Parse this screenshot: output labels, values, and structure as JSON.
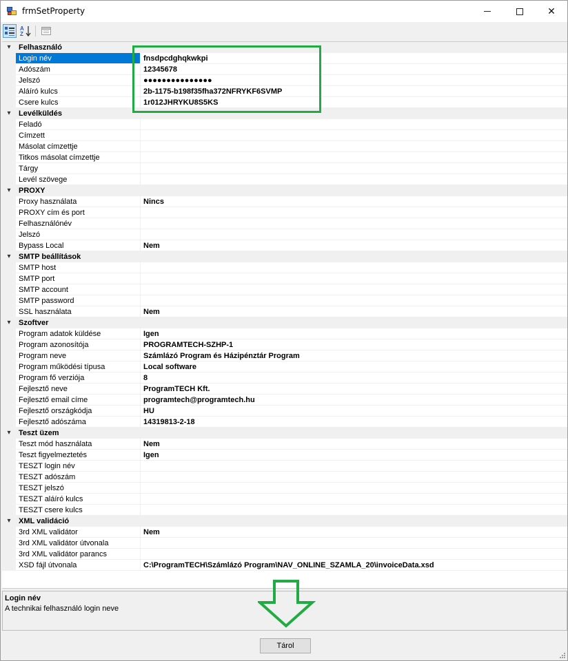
{
  "window": {
    "title": "frmSetProperty",
    "close_glyph": "✕"
  },
  "toolbar": {
    "icons": [
      "categorized-icon",
      "alphabetical-icon",
      "property-pages-icon"
    ]
  },
  "grid": {
    "categories": [
      {
        "label": "Felhasználó",
        "properties": [
          {
            "name": "Login név",
            "value": "fnsdpcdghqkwkpi",
            "selected": true
          },
          {
            "name": "Adószám",
            "value": "12345678"
          },
          {
            "name": "Jelszó",
            "value": "●●●●●●●●●●●●●●●"
          },
          {
            "name": "Aláíró kulcs",
            "value": "2b-1175-b198f35fha372NFRYKF6SVMP"
          },
          {
            "name": "Csere kulcs",
            "value": "1r012JHRYKU8S5KS"
          }
        ]
      },
      {
        "label": "Levélküldés",
        "properties": [
          {
            "name": "Feladó",
            "value": ""
          },
          {
            "name": "Címzett",
            "value": ""
          },
          {
            "name": "Másolat címzettje",
            "value": ""
          },
          {
            "name": "Titkos másolat címzettje",
            "value": ""
          },
          {
            "name": "Tárgy",
            "value": ""
          },
          {
            "name": "Levél szövege",
            "value": ""
          }
        ]
      },
      {
        "label": "PROXY",
        "properties": [
          {
            "name": "Proxy használata",
            "value": "Nincs"
          },
          {
            "name": "PROXY cím és port",
            "value": ""
          },
          {
            "name": "Felhasználónév",
            "value": ""
          },
          {
            "name": "Jelszó",
            "value": ""
          },
          {
            "name": "Bypass Local",
            "value": "Nem"
          }
        ]
      },
      {
        "label": "SMTP beállítások",
        "properties": [
          {
            "name": "SMTP host",
            "value": ""
          },
          {
            "name": "SMTP port",
            "value": ""
          },
          {
            "name": "SMTP account",
            "value": ""
          },
          {
            "name": "SMTP password",
            "value": ""
          },
          {
            "name": "SSL használata",
            "value": "Nem"
          }
        ]
      },
      {
        "label": "Szoftver",
        "properties": [
          {
            "name": "Program adatok küldése",
            "value": "Igen"
          },
          {
            "name": "Program azonosítója",
            "value": "PROGRAMTECH-SZHP-1"
          },
          {
            "name": "Program neve",
            "value": "Számlázó Program és Házipénztár Program"
          },
          {
            "name": "Program működési típusa",
            "value": "Local software"
          },
          {
            "name": "Program fő verziója",
            "value": "8"
          },
          {
            "name": "Fejlesztő neve",
            "value": "ProgramTECH Kft."
          },
          {
            "name": "Fejlesztő email címe",
            "value": "programtech@programtech.hu"
          },
          {
            "name": "Fejlesztő országkódja",
            "value": "HU"
          },
          {
            "name": "Fejlesztő adószáma",
            "value": "14319813-2-18"
          }
        ]
      },
      {
        "label": "Teszt üzem",
        "properties": [
          {
            "name": "Teszt mód használata",
            "value": "Nem"
          },
          {
            "name": "Teszt figyelmeztetés",
            "value": "Igen"
          },
          {
            "name": "TESZT login név",
            "value": ""
          },
          {
            "name": "TESZT adószám",
            "value": ""
          },
          {
            "name": "TESZT jelszó",
            "value": ""
          },
          {
            "name": "TESZT aláíró kulcs",
            "value": ""
          },
          {
            "name": "TESZT csere kulcs",
            "value": ""
          }
        ]
      },
      {
        "label": "XML validáció",
        "properties": [
          {
            "name": "3rd XML validátor",
            "value": "Nem"
          },
          {
            "name": "3rd XML validátor útvonala",
            "value": ""
          },
          {
            "name": "3rd XML validátor parancs",
            "value": ""
          },
          {
            "name": "XSD fájl útvonala",
            "value": "C:\\ProgramTECH\\Számlázó Program\\NAV_ONLINE_SZAMLA_20\\invoiceData.xsd"
          }
        ]
      }
    ]
  },
  "help": {
    "title": "Login név",
    "description": "A technikai felhasználó login neve"
  },
  "footer": {
    "save_label": "Tárol"
  },
  "colors": {
    "selection": "#0078d7",
    "annotation_green": "#22aa44"
  }
}
